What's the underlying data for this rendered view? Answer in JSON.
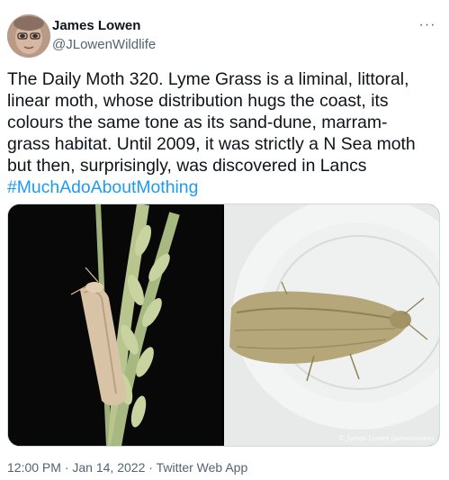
{
  "author": {
    "display_name": "James Lowen",
    "handle": "@JLowenWildlife"
  },
  "more_icon": "more-horizontal-icon",
  "tweet": {
    "text": "The Daily Moth 320. Lyme Grass is a liminal, littoral,\nlinear moth, whose distribution hugs the coast, its\ncolours the same tone as its sand-dune, marram-\ngrass habitat. Until 2009, it was strictly a N Sea moth\nbut then, surprisingly, was discovered in Lancs",
    "hashtag": "#MuchAdoAboutMothing"
  },
  "media": {
    "photo_right_credit": "© James Lowen (jameslowen)"
  },
  "meta": {
    "time": "12:00 PM",
    "separator": " · ",
    "date": "Jan 14, 2022",
    "source": "Twitter Web App"
  },
  "colors": {
    "link": "#1d9bf0",
    "secondary_text": "#536471",
    "primary_text": "#0f1419"
  }
}
